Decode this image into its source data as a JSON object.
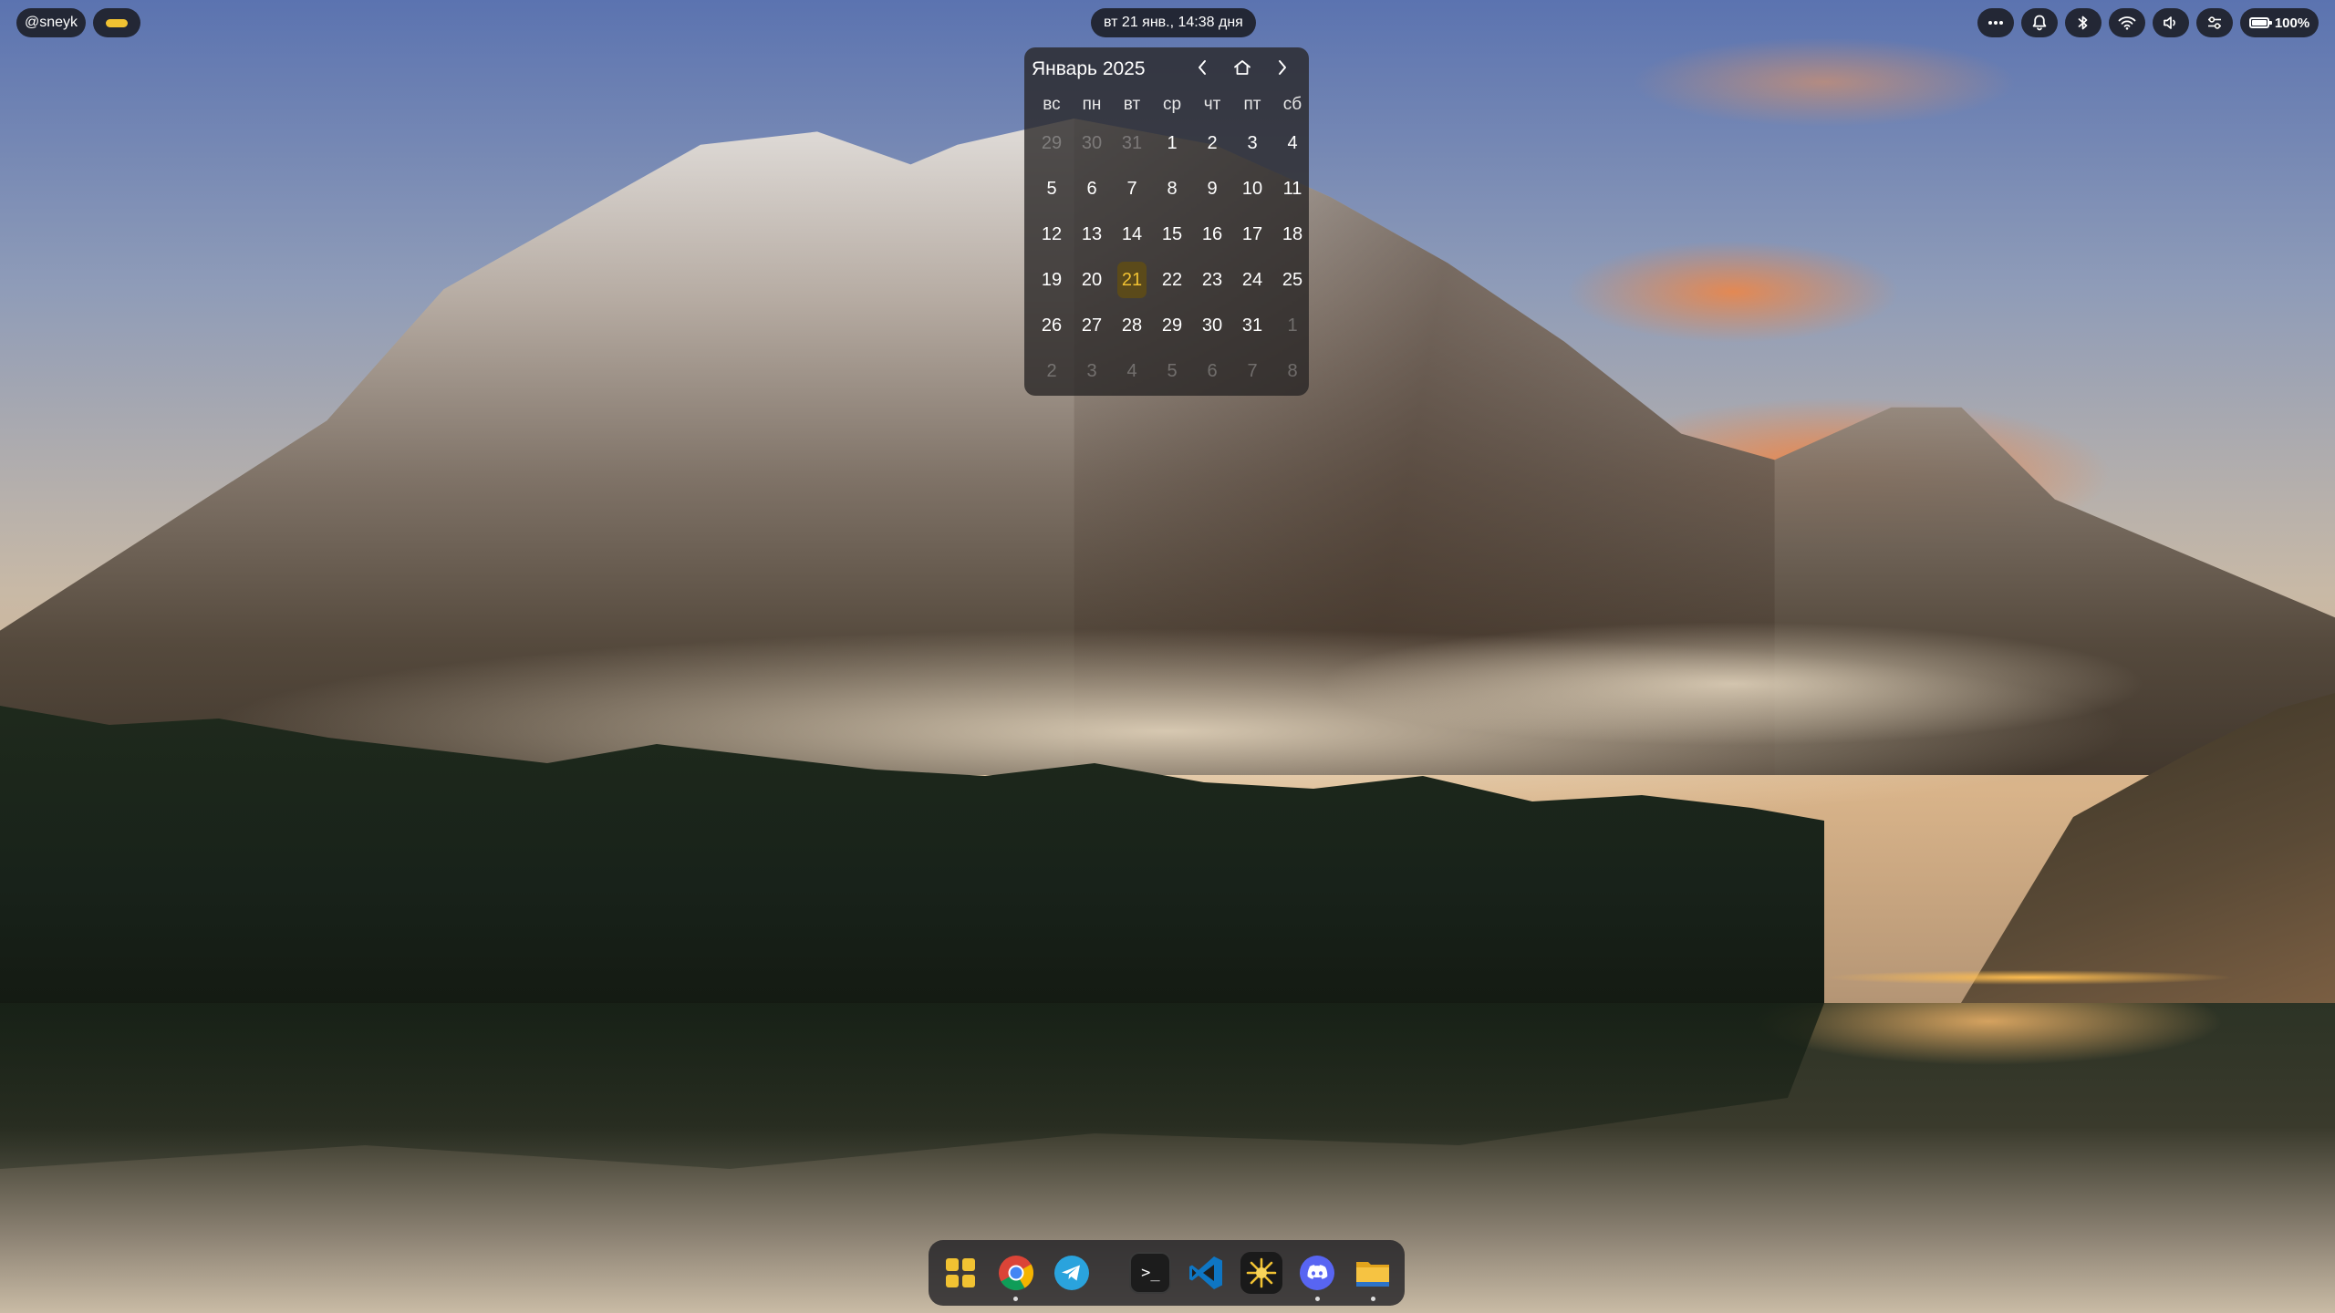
{
  "topbar": {
    "user_label": "@sneyk",
    "clock_label": "вт 21 янв., 14:38 дня",
    "workspace_accent": "#f1c232",
    "tray": {
      "overflow_icon": "more-horizontal-icon",
      "notifications_icon": "bell-icon",
      "bluetooth_icon": "bluetooth-icon",
      "wifi_icon": "wifi-icon",
      "volume_icon": "speaker-icon",
      "settings_icon": "sliders-icon",
      "battery_icon": "battery-icon",
      "battery_label": "100%"
    }
  },
  "calendar": {
    "title": "Январь 2025",
    "nav": {
      "prev_icon": "chevron-left-icon",
      "home_icon": "home-icon",
      "next_icon": "chevron-right-icon"
    },
    "weekdays": [
      "вс",
      "пн",
      "вт",
      "ср",
      "чт",
      "пт",
      "сб"
    ],
    "today_accent": "#f1c232",
    "weeks": [
      [
        {
          "d": "29",
          "other": true
        },
        {
          "d": "30",
          "other": true
        },
        {
          "d": "31",
          "other": true
        },
        {
          "d": "1"
        },
        {
          "d": "2"
        },
        {
          "d": "3"
        },
        {
          "d": "4"
        }
      ],
      [
        {
          "d": "5"
        },
        {
          "d": "6"
        },
        {
          "d": "7"
        },
        {
          "d": "8"
        },
        {
          "d": "9"
        },
        {
          "d": "10"
        },
        {
          "d": "11"
        }
      ],
      [
        {
          "d": "12"
        },
        {
          "d": "13"
        },
        {
          "d": "14"
        },
        {
          "d": "15"
        },
        {
          "d": "16"
        },
        {
          "d": "17"
        },
        {
          "d": "18"
        }
      ],
      [
        {
          "d": "19"
        },
        {
          "d": "20"
        },
        {
          "d": "21",
          "today": true
        },
        {
          "d": "22"
        },
        {
          "d": "23"
        },
        {
          "d": "24"
        },
        {
          "d": "25"
        }
      ],
      [
        {
          "d": "26"
        },
        {
          "d": "27"
        },
        {
          "d": "28"
        },
        {
          "d": "29"
        },
        {
          "d": "30"
        },
        {
          "d": "31"
        },
        {
          "d": "1",
          "other": true
        }
      ],
      [
        {
          "d": "2",
          "other": true
        },
        {
          "d": "3",
          "other": true
        },
        {
          "d": "4",
          "other": true
        },
        {
          "d": "5",
          "other": true
        },
        {
          "d": "6",
          "other": true
        },
        {
          "d": "7",
          "other": true
        },
        {
          "d": "8",
          "other": true
        }
      ]
    ]
  },
  "dock": {
    "items": [
      {
        "name": "app-launcher",
        "icon": "grid-icon",
        "running": false
      },
      {
        "name": "chrome",
        "icon": "chrome-icon",
        "running": true
      },
      {
        "name": "telegram",
        "icon": "telegram-icon",
        "running": false
      },
      {
        "name": "terminal",
        "icon": "terminal-icon",
        "running": false,
        "glyph": ">_"
      },
      {
        "name": "vscode",
        "icon": "vscode-icon",
        "running": false
      },
      {
        "name": "spark",
        "icon": "sparkle-icon",
        "running": false
      },
      {
        "name": "discord",
        "icon": "discord-icon",
        "running": true
      },
      {
        "name": "files",
        "icon": "folder-icon",
        "running": true
      }
    ]
  }
}
